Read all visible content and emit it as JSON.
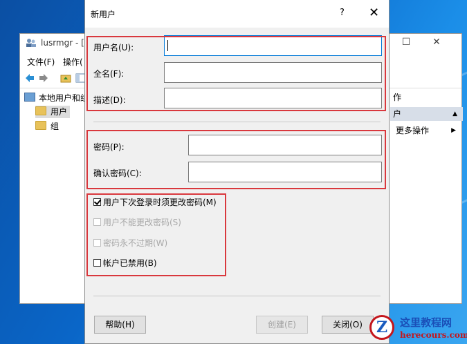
{
  "background_window": {
    "title": "lusrmgr - [",
    "menus": [
      "文件(F)",
      "操作("
    ],
    "tree": {
      "root": "本地用户和组",
      "items": [
        "用户",
        "组"
      ]
    },
    "actions": {
      "header": "作",
      "subheader": "户",
      "more": "更多操作"
    }
  },
  "dialog": {
    "title": "新用户",
    "help_glyph": "?",
    "close_glyph": "✕",
    "fields": {
      "username_label": "用户名(U):",
      "fullname_label": "全名(F):",
      "description_label": "描述(D):",
      "password_label": "密码(P):",
      "confirm_label": "确认密码(C):",
      "username_value": "",
      "fullname_value": "",
      "description_value": "",
      "password_value": "",
      "confirm_value": ""
    },
    "options": {
      "must_change": "用户下次登录时须更改密码(M)",
      "cannot_change": "用户不能更改密码(S)",
      "never_expires": "密码永不过期(W)",
      "disabled": "帐户已禁用(B)"
    },
    "buttons": {
      "help": "帮助(H)",
      "create": "创建(E)",
      "close": "关闭(O)"
    }
  },
  "watermark": {
    "logo_letter": "Z",
    "name": "这里教程网",
    "url": "herecours.com"
  },
  "colors": {
    "highlight_box": "#d9383d",
    "focus_border": "#0078d7",
    "desktop": "#0a66c8"
  }
}
